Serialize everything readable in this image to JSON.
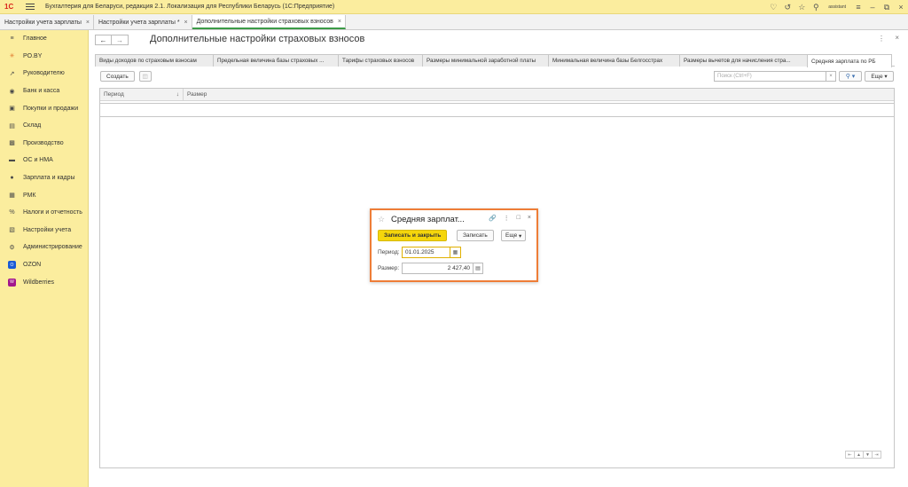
{
  "app": {
    "logo": "1С",
    "title": "Бухгалтерия для Беларуси, редакция 2.1. Локализация для Республики Беларусь   (1С:Предприятие)",
    "user": "assistant"
  },
  "open_tabs": [
    {
      "label": "Настройки учета зарплаты"
    },
    {
      "label": "Настройки учета зарплаты *"
    },
    {
      "label": "Дополнительные настройки страховых взносов"
    }
  ],
  "sidebar": {
    "items": [
      {
        "label": "Главное",
        "icon": "hamburger-icon"
      },
      {
        "label": "PO.BY",
        "icon": "star-icon"
      },
      {
        "label": "Руководителю",
        "icon": "trend-icon"
      },
      {
        "label": "Банк и касса",
        "icon": "coin-icon"
      },
      {
        "label": "Покупки и продажи",
        "icon": "cart-icon"
      },
      {
        "label": "Склад",
        "icon": "warehouse-icon"
      },
      {
        "label": "Производство",
        "icon": "factory-icon"
      },
      {
        "label": "ОС и НМА",
        "icon": "truck-icon"
      },
      {
        "label": "Зарплата и кадры",
        "icon": "person-icon"
      },
      {
        "label": "РМК",
        "icon": "register-icon"
      },
      {
        "label": "Налоги и отчетность",
        "icon": "percent-icon"
      },
      {
        "label": "Настройки учета",
        "icon": "book-icon"
      },
      {
        "label": "Администрирование",
        "icon": "gear-icon"
      },
      {
        "label": "OZON",
        "icon": "ozon-icon"
      },
      {
        "label": "Wildberries",
        "icon": "wildberries-icon"
      }
    ]
  },
  "page": {
    "title": "Дополнительные настройки страховых взносов",
    "subtabs": [
      "Виды доходов по страховым взносам",
      "Предельная величина базы страховых ...",
      "Тарифы страховых взносов",
      "Размеры минимальной заработной платы",
      "Минимальная величина базы Белгосстрах",
      "Размеры вычетов для начисления стра...",
      "Средняя зарплата по РБ"
    ],
    "toolbar": {
      "create_label": "Создать",
      "search_placeholder": "Поиск (Ctrl+F)",
      "more_label": "Еще"
    },
    "table": {
      "columns": [
        "Период",
        "Размер"
      ]
    }
  },
  "modal": {
    "title": "Средняя зарплат...",
    "save_close_label": "Записать и закрыть",
    "save_label": "Записать",
    "more_label": "Еще",
    "period_label": "Период:",
    "period_value": "01.01.2025",
    "size_label": "Размер:",
    "size_value": "2 427,40"
  },
  "colors": {
    "accent_yellow": "#fbed9e",
    "modal_border": "#ee7d37",
    "primary_button": "#f5d60b",
    "active_tab_underline": "#3c9b47"
  }
}
